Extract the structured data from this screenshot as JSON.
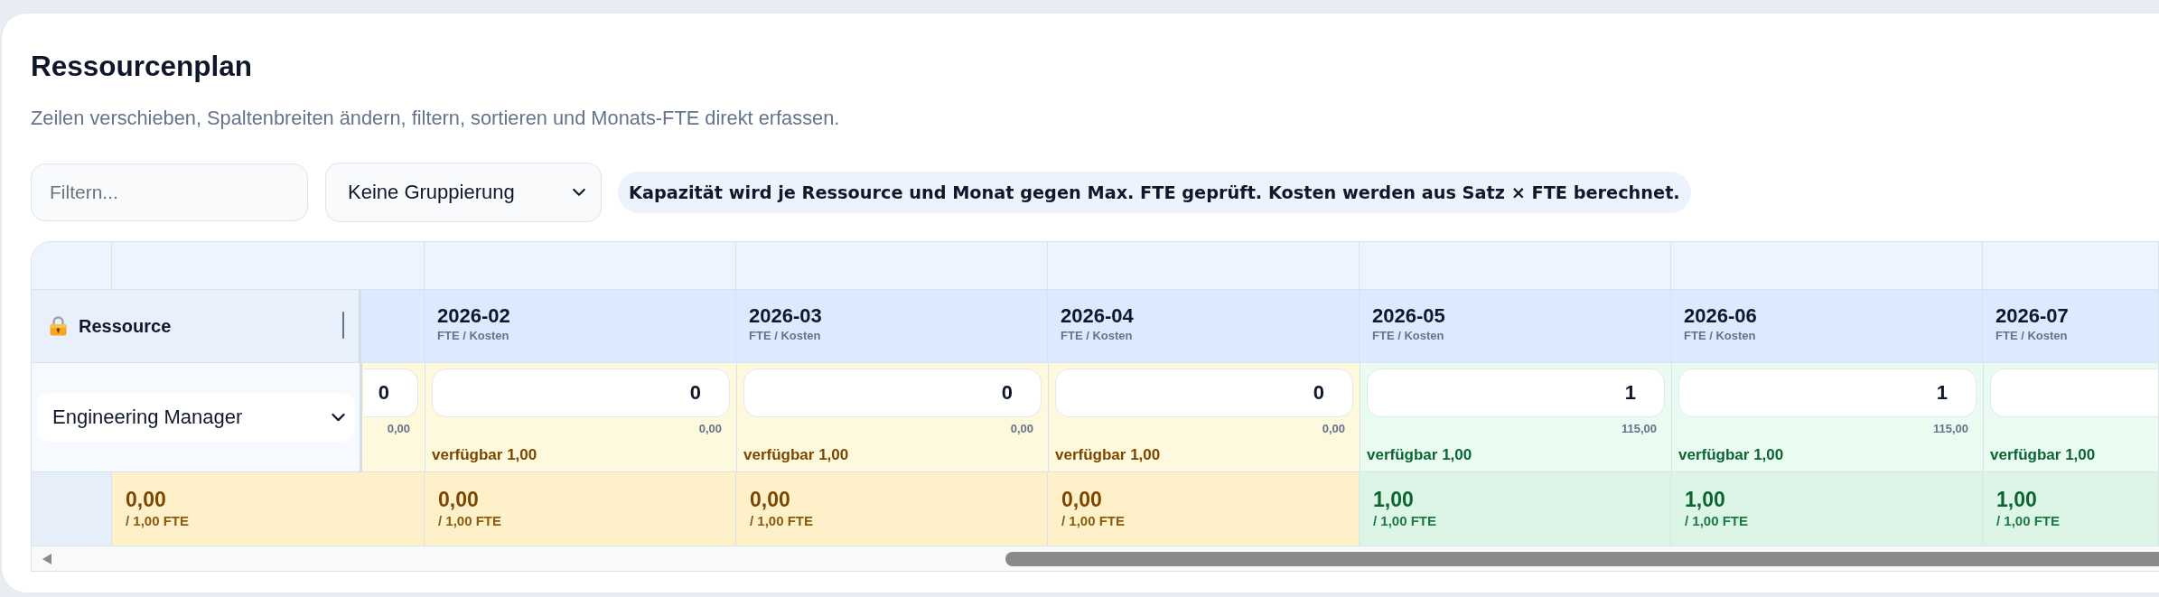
{
  "page": {
    "title": "Ressourcenplan",
    "subtitle": "Zeilen verschieben, Spaltenbreiten ändern, filtern, sortieren und Monats-FTE direkt erfassen."
  },
  "toolbar": {
    "filter": {
      "placeholder": "Filtern..."
    },
    "grouping": {
      "value": "Keine Gruppierung"
    },
    "info": "Kapazität wird je Ressource und Monat gegen Max. FTE geprüft. Kosten werden aus Satz × FTE berechnet."
  },
  "table": {
    "resource_header": "Ressource",
    "months": [
      {
        "label": "2026-02",
        "sublabel": "FTE / Kosten"
      },
      {
        "label": "2026-03",
        "sublabel": "FTE / Kosten"
      },
      {
        "label": "2026-04",
        "sublabel": "FTE / Kosten"
      },
      {
        "label": "2026-05",
        "sublabel": "FTE / Kosten"
      },
      {
        "label": "2026-06",
        "sublabel": "FTE / Kosten"
      },
      {
        "label": "2026-07",
        "sublabel": "FTE / Kosten"
      }
    ],
    "rows": [
      {
        "resource": "Engineering Manager",
        "cells": [
          {
            "fte": "0",
            "cost": "0,00",
            "under_capacity": true
          },
          {
            "fte": "0",
            "cost": "0,00",
            "available": "verfügbar 1,00",
            "under_capacity": true
          },
          {
            "fte": "0",
            "cost": "0,00",
            "available": "verfügbar 1,00",
            "under_capacity": true
          },
          {
            "fte": "0",
            "cost": "0,00",
            "available": "verfügbar 1,00",
            "under_capacity": true
          },
          {
            "fte": "1",
            "cost": "115,00",
            "available": "verfügbar 1,00",
            "under_capacity": false
          },
          {
            "fte": "1",
            "cost": "115,00",
            "available": "verfügbar 1,00",
            "under_capacity": false
          },
          {
            "available": "verfügbar 1,00",
            "under_capacity": false
          }
        ]
      }
    ],
    "totals": [
      {
        "value": "0,00",
        "capacity": "/ 1,00 FTE",
        "under_capacity": true
      },
      {
        "value": "0,00",
        "capacity": "/ 1,00 FTE",
        "under_capacity": true
      },
      {
        "value": "0,00",
        "capacity": "/ 1,00 FTE",
        "under_capacity": true
      },
      {
        "value": "0,00",
        "capacity": "/ 1,00 FTE",
        "under_capacity": true
      },
      {
        "value": "1,00",
        "capacity": "/ 1,00 FTE",
        "under_capacity": false
      },
      {
        "value": "1,00",
        "capacity": "/ 1,00 FTE",
        "under_capacity": false
      },
      {
        "value": "1,00",
        "capacity": "/ 1,00 FTE",
        "under_capacity": false
      }
    ]
  }
}
